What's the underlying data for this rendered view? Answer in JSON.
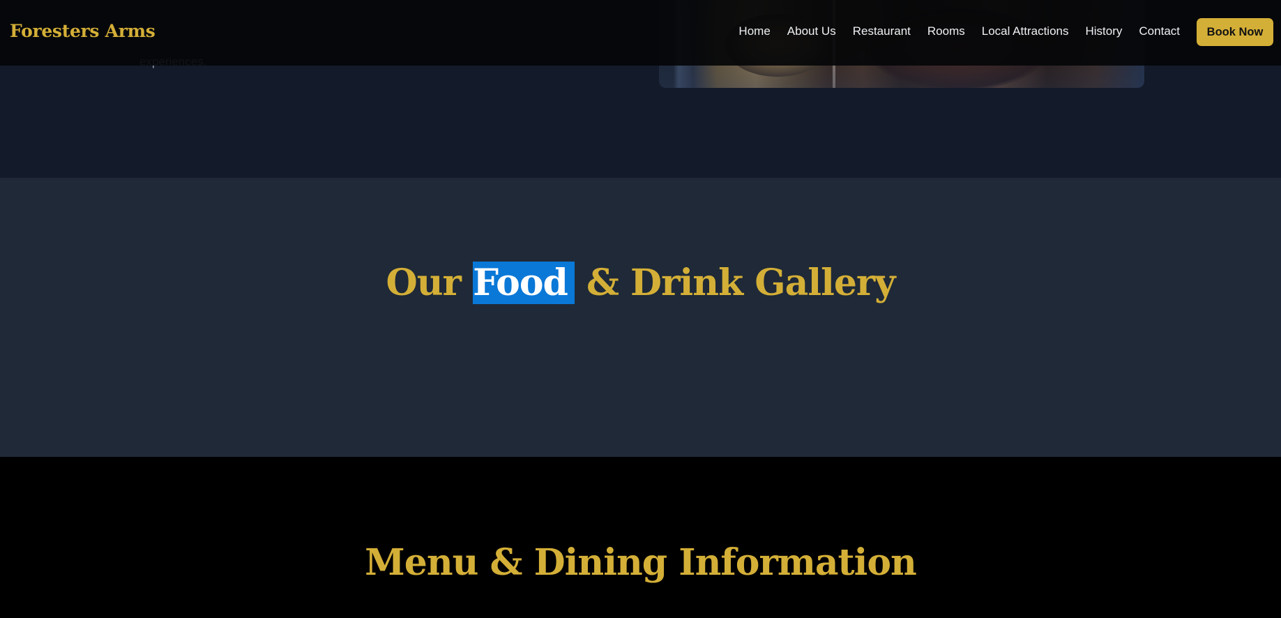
{
  "intro": {
    "text_fragment": "experiences."
  },
  "nav": {
    "brand": "Foresters Arms",
    "links": [
      "Home",
      "About Us",
      "Restaurant",
      "Rooms",
      "Local Attractions",
      "History",
      "Contact"
    ],
    "book_button": "Book Now"
  },
  "gallery": {
    "title_before": "Our ",
    "title_selected": "Food",
    "title_after": " & Drink Gallery"
  },
  "menu": {
    "title": "Menu & Dining Information"
  },
  "colors": {
    "accent": "#d4af37",
    "selection": "#0a78d7",
    "gallery_bg": "#1f2937",
    "intro_bg": "#131a29",
    "menu_bg": "#000000",
    "nav_bg": "#050609"
  }
}
